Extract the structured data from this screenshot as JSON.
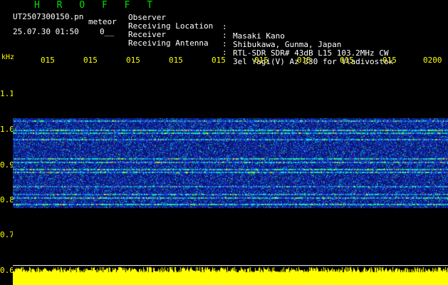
{
  "header": {
    "title": "H R O F F T",
    "filename": "UT2507300150.pn",
    "type_label": "meteor",
    "datetime": "25.07.30 01:50",
    "count": "0__"
  },
  "info": [
    {
      "label": "Observer",
      "value": "Masaki Kano"
    },
    {
      "label": "Receiving Location",
      "value": "Shibukawa, Gunma, Japan"
    },
    {
      "label": "Receiver",
      "value": "RTL-SDR SDR# 43dB L15 103.2MHz CW"
    },
    {
      "label": "Receiving Antenna",
      "value": "3el Yagi(V) Az 330 for Vladivostok"
    }
  ],
  "axis": {
    "unit": "kHz",
    "time_ticks": [
      "015",
      "015",
      "015",
      "015",
      "015",
      "015",
      "015",
      "015",
      "015",
      "0200"
    ],
    "freq_ticks": [
      "1.1",
      "1.0",
      "0.9",
      "0.8",
      "0.7",
      "0.6"
    ]
  },
  "colors": {
    "background": "#000000",
    "title_green": "#00e000",
    "axis_yellow": "#ffff00",
    "text_white": "#ffffff",
    "spectrum_blue": "#1020c0",
    "bar_yellow": "#ffff00"
  }
}
